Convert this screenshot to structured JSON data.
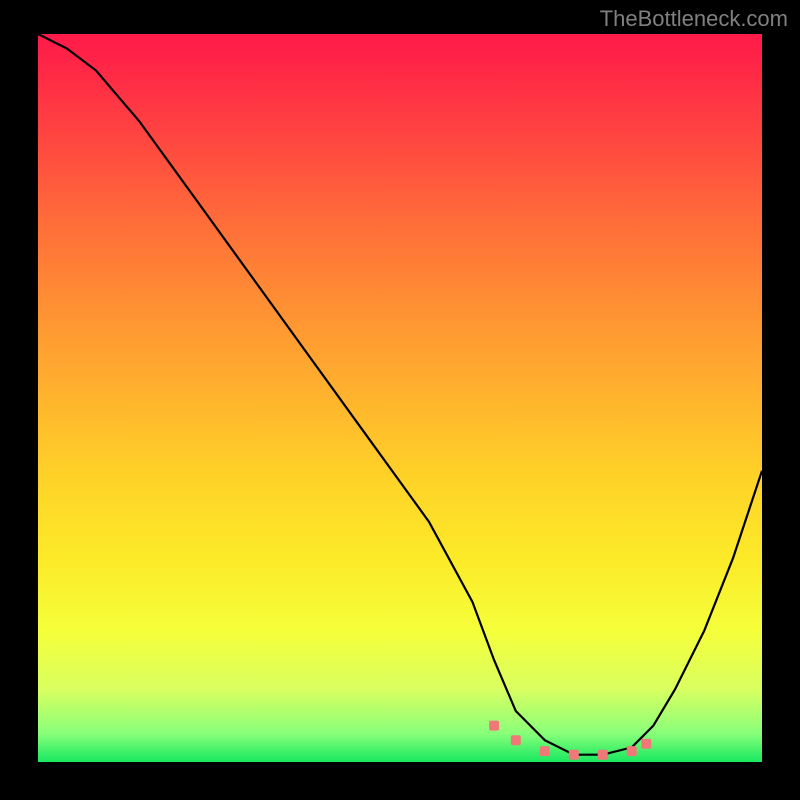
{
  "watermark": "TheBottleneck.com",
  "chart_data": {
    "type": "line",
    "title": "",
    "xlabel": "",
    "ylabel": "",
    "xlim": [
      0,
      100
    ],
    "ylim": [
      0,
      100
    ],
    "series": [
      {
        "name": "curve",
        "x": [
          0,
          4,
          8,
          14,
          22,
          30,
          38,
          46,
          54,
          60,
          63,
          66,
          70,
          74,
          78,
          82,
          85,
          88,
          92,
          96,
          100
        ],
        "values": [
          100,
          98,
          95,
          88,
          77,
          66,
          55,
          44,
          33,
          22,
          14,
          7,
          3,
          1,
          1,
          2,
          5,
          10,
          18,
          28,
          40
        ]
      }
    ],
    "markers": {
      "name": "flat-region",
      "x": [
        63,
        66,
        70,
        74,
        78,
        82,
        84
      ],
      "values": [
        5,
        3,
        1.5,
        1,
        1,
        1.5,
        2.5
      ],
      "color": "#f07878"
    },
    "background_gradient": {
      "top": "#ff1a4a",
      "bottom": "#18e860"
    }
  }
}
